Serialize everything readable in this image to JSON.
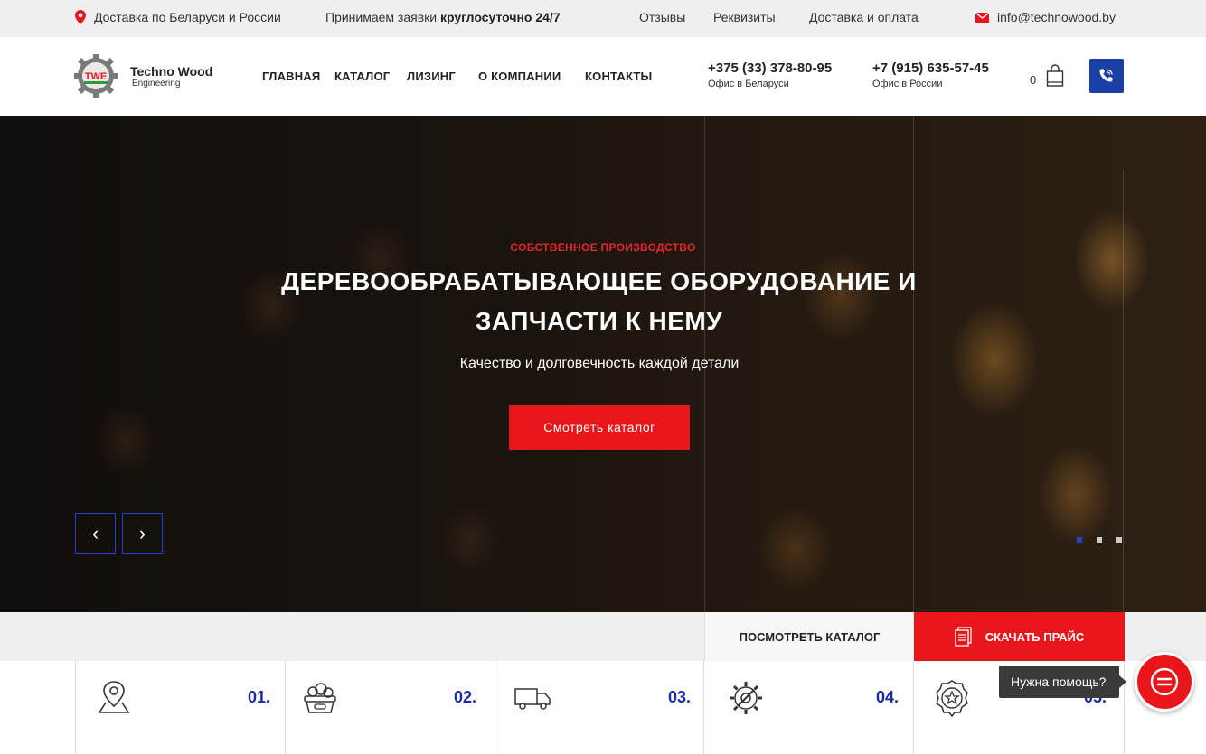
{
  "topbar": {
    "delivery": "Доставка по Беларуси и России",
    "accept_prefix": "Принимаем заявки ",
    "accept_bold": "круглосуточно 24/7",
    "links": [
      "Отзывы",
      "Реквизиты",
      "Доставка и оплата"
    ],
    "email": "info@technowood.by"
  },
  "header": {
    "logo_name": "Techno Wood",
    "logo_sub": "Engineering",
    "logo_mark": "TWE",
    "nav": [
      "ГЛАВНАЯ",
      "КАТАЛОГ",
      "ЛИЗИНГ",
      "О КОМПАНИИ",
      "КОНТАКТЫ"
    ],
    "phones": [
      {
        "number": "+375 (33) 378-80-95",
        "label": "Офис в Беларуси"
      },
      {
        "number": "+7 (915) 635-57-45",
        "label": "Офис в России"
      }
    ],
    "cart_count": "0"
  },
  "hero": {
    "subtitle": "СОБСТВЕННОЕ ПРОИЗВОДСТВО",
    "title": "ДЕРЕВООБРАБАТЫВАЮЩЕЕ ОБОРУДОВАНИЕ И ЗАПЧАСТИ К НЕМУ",
    "description": "Качество и долговечность каждой детали",
    "button": "Смотреть каталог",
    "prev": "‹",
    "next": "›",
    "slides_total": 3,
    "active_slide": 1
  },
  "actions": {
    "catalog": "ПОСМОТРЕТЬ КАТАЛОГ",
    "price": "СКАЧАТЬ ПРАЙС"
  },
  "features": [
    {
      "num": "01.",
      "icon": "map-pin-icon"
    },
    {
      "num": "02.",
      "icon": "basket-icon"
    },
    {
      "num": "03.",
      "icon": "truck-icon"
    },
    {
      "num": "04.",
      "icon": "gear-wrench-icon"
    },
    {
      "num": "05.",
      "icon": "award-star-icon"
    }
  ],
  "help": {
    "text": "Нужна помощь?"
  },
  "colors": {
    "accent_red": "#e8161b",
    "accent_blue": "#1a3fa5",
    "topbar_bg": "#efefef"
  }
}
